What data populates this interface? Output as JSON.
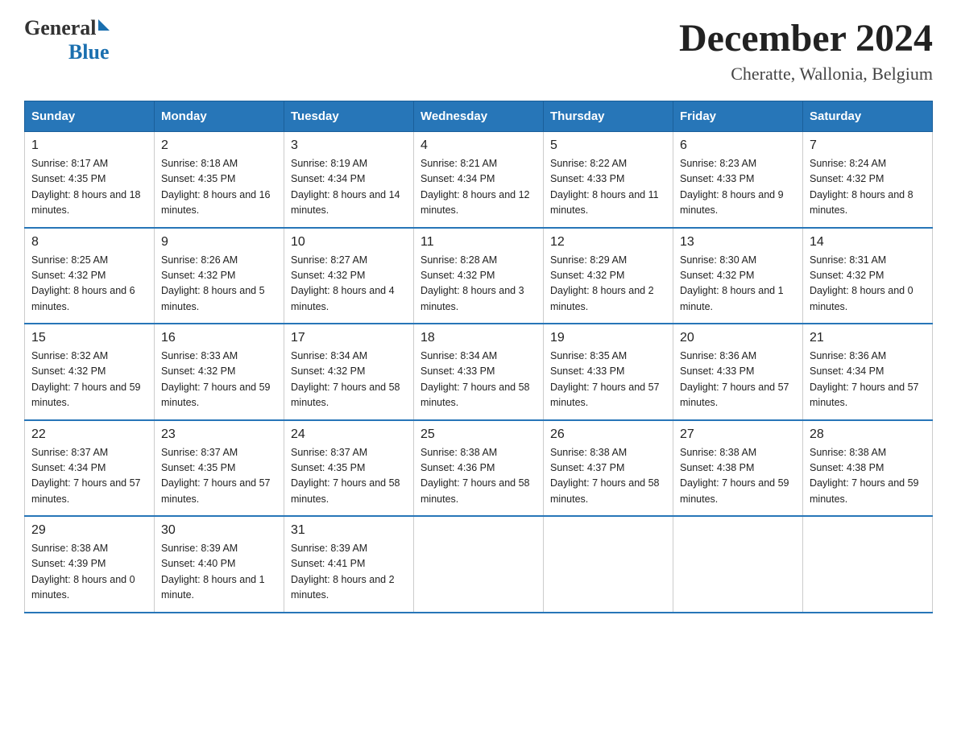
{
  "header": {
    "logo_general": "General",
    "logo_blue": "Blue",
    "title": "December 2024",
    "subtitle": "Cheratte, Wallonia, Belgium"
  },
  "days_of_week": [
    "Sunday",
    "Monday",
    "Tuesday",
    "Wednesday",
    "Thursday",
    "Friday",
    "Saturday"
  ],
  "weeks": [
    [
      {
        "day": "1",
        "sunrise": "8:17 AM",
        "sunset": "4:35 PM",
        "daylight": "8 hours and 18 minutes."
      },
      {
        "day": "2",
        "sunrise": "8:18 AM",
        "sunset": "4:35 PM",
        "daylight": "8 hours and 16 minutes."
      },
      {
        "day": "3",
        "sunrise": "8:19 AM",
        "sunset": "4:34 PM",
        "daylight": "8 hours and 14 minutes."
      },
      {
        "day": "4",
        "sunrise": "8:21 AM",
        "sunset": "4:34 PM",
        "daylight": "8 hours and 12 minutes."
      },
      {
        "day": "5",
        "sunrise": "8:22 AM",
        "sunset": "4:33 PM",
        "daylight": "8 hours and 11 minutes."
      },
      {
        "day": "6",
        "sunrise": "8:23 AM",
        "sunset": "4:33 PM",
        "daylight": "8 hours and 9 minutes."
      },
      {
        "day": "7",
        "sunrise": "8:24 AM",
        "sunset": "4:32 PM",
        "daylight": "8 hours and 8 minutes."
      }
    ],
    [
      {
        "day": "8",
        "sunrise": "8:25 AM",
        "sunset": "4:32 PM",
        "daylight": "8 hours and 6 minutes."
      },
      {
        "day": "9",
        "sunrise": "8:26 AM",
        "sunset": "4:32 PM",
        "daylight": "8 hours and 5 minutes."
      },
      {
        "day": "10",
        "sunrise": "8:27 AM",
        "sunset": "4:32 PM",
        "daylight": "8 hours and 4 minutes."
      },
      {
        "day": "11",
        "sunrise": "8:28 AM",
        "sunset": "4:32 PM",
        "daylight": "8 hours and 3 minutes."
      },
      {
        "day": "12",
        "sunrise": "8:29 AM",
        "sunset": "4:32 PM",
        "daylight": "8 hours and 2 minutes."
      },
      {
        "day": "13",
        "sunrise": "8:30 AM",
        "sunset": "4:32 PM",
        "daylight": "8 hours and 1 minute."
      },
      {
        "day": "14",
        "sunrise": "8:31 AM",
        "sunset": "4:32 PM",
        "daylight": "8 hours and 0 minutes."
      }
    ],
    [
      {
        "day": "15",
        "sunrise": "8:32 AM",
        "sunset": "4:32 PM",
        "daylight": "7 hours and 59 minutes."
      },
      {
        "day": "16",
        "sunrise": "8:33 AM",
        "sunset": "4:32 PM",
        "daylight": "7 hours and 59 minutes."
      },
      {
        "day": "17",
        "sunrise": "8:34 AM",
        "sunset": "4:32 PM",
        "daylight": "7 hours and 58 minutes."
      },
      {
        "day": "18",
        "sunrise": "8:34 AM",
        "sunset": "4:33 PM",
        "daylight": "7 hours and 58 minutes."
      },
      {
        "day": "19",
        "sunrise": "8:35 AM",
        "sunset": "4:33 PM",
        "daylight": "7 hours and 57 minutes."
      },
      {
        "day": "20",
        "sunrise": "8:36 AM",
        "sunset": "4:33 PM",
        "daylight": "7 hours and 57 minutes."
      },
      {
        "day": "21",
        "sunrise": "8:36 AM",
        "sunset": "4:34 PM",
        "daylight": "7 hours and 57 minutes."
      }
    ],
    [
      {
        "day": "22",
        "sunrise": "8:37 AM",
        "sunset": "4:34 PM",
        "daylight": "7 hours and 57 minutes."
      },
      {
        "day": "23",
        "sunrise": "8:37 AM",
        "sunset": "4:35 PM",
        "daylight": "7 hours and 57 minutes."
      },
      {
        "day": "24",
        "sunrise": "8:37 AM",
        "sunset": "4:35 PM",
        "daylight": "7 hours and 58 minutes."
      },
      {
        "day": "25",
        "sunrise": "8:38 AM",
        "sunset": "4:36 PM",
        "daylight": "7 hours and 58 minutes."
      },
      {
        "day": "26",
        "sunrise": "8:38 AM",
        "sunset": "4:37 PM",
        "daylight": "7 hours and 58 minutes."
      },
      {
        "day": "27",
        "sunrise": "8:38 AM",
        "sunset": "4:38 PM",
        "daylight": "7 hours and 59 minutes."
      },
      {
        "day": "28",
        "sunrise": "8:38 AM",
        "sunset": "4:38 PM",
        "daylight": "7 hours and 59 minutes."
      }
    ],
    [
      {
        "day": "29",
        "sunrise": "8:38 AM",
        "sunset": "4:39 PM",
        "daylight": "8 hours and 0 minutes."
      },
      {
        "day": "30",
        "sunrise": "8:39 AM",
        "sunset": "4:40 PM",
        "daylight": "8 hours and 1 minute."
      },
      {
        "day": "31",
        "sunrise": "8:39 AM",
        "sunset": "4:41 PM",
        "daylight": "8 hours and 2 minutes."
      },
      null,
      null,
      null,
      null
    ]
  ]
}
